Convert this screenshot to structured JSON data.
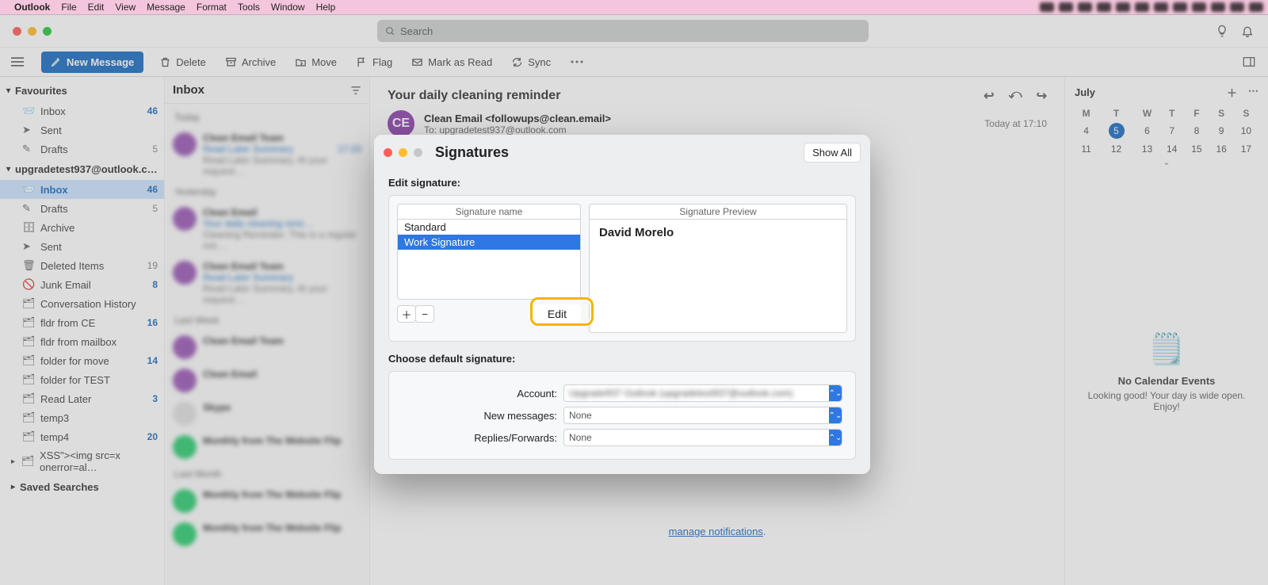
{
  "macmenu": {
    "app": "Outlook",
    "items": [
      "File",
      "Edit",
      "View",
      "Message",
      "Format",
      "Tools",
      "Window",
      "Help"
    ]
  },
  "search_placeholder": "Search",
  "toolbar": {
    "new": "New Message",
    "delete": "Delete",
    "archive": "Archive",
    "move": "Move",
    "flag": "Flag",
    "markread": "Mark as Read",
    "sync": "Sync"
  },
  "sidebar": {
    "favourites": "Favourites",
    "fav": {
      "inbox": {
        "label": "Inbox",
        "count": "46"
      },
      "sent": {
        "label": "Sent"
      },
      "drafts": {
        "label": "Drafts",
        "count": "5"
      }
    },
    "account": "upgradetest937@outlook.c…",
    "items": [
      {
        "label": "Inbox",
        "count": "46",
        "sel": true
      },
      {
        "label": "Drafts",
        "count": "5"
      },
      {
        "label": "Archive"
      },
      {
        "label": "Sent"
      },
      {
        "label": "Deleted Items",
        "count": "19"
      },
      {
        "label": "Junk Email",
        "count": "8"
      },
      {
        "label": "Conversation History"
      },
      {
        "label": "fldr from CE",
        "count": "16"
      },
      {
        "label": "fldr from mailbox"
      },
      {
        "label": "folder for move",
        "count": "14"
      },
      {
        "label": "folder for TEST"
      },
      {
        "label": "Read Later",
        "count": "3"
      },
      {
        "label": "temp3"
      },
      {
        "label": "temp4",
        "count": "20"
      },
      {
        "label": "XSS\"><img src=x onerror=al…"
      }
    ],
    "saved": "Saved Searches"
  },
  "list": {
    "title": "Inbox",
    "today": "Today",
    "yesterday": "Yesterday",
    "lastweek": "Last Week",
    "lastmonth": "Last Month",
    "r": {
      "nm1": "Clean Email Team",
      "ln1": "Read Later Summary",
      "tm": "17:20",
      "pv": "Read Later Summary. At your request…",
      "nm2": "Clean Email",
      "ln2": "Your daily cleaning remi…",
      "pv2": "Cleaning Reminder. This is a regular not…"
    }
  },
  "reader": {
    "subject": "Your daily cleaning reminder",
    "avatar": "CE",
    "sender": "Clean Email <followups@clean.email>",
    "to_lbl": "To:",
    "to": "upgradetest937@outlook.com",
    "time": "Today at 17:10",
    "link": "manage notifications"
  },
  "agenda": {
    "month": "July",
    "dow": [
      "M",
      "T",
      "W",
      "T",
      "F",
      "S",
      "S"
    ],
    "rows": [
      [
        "4",
        "5",
        "6",
        "7",
        "8",
        "9",
        "10"
      ],
      [
        "11",
        "12",
        "13",
        "14",
        "15",
        "16",
        "17"
      ]
    ],
    "noevt": "No Calendar Events",
    "noevt2": "Looking good! Your day is wide open. Enjoy!"
  },
  "modal": {
    "title": "Signatures",
    "showall": "Show All",
    "edit_label": "Edit signature:",
    "sig_name_hdr": "Signature name",
    "sig1": "Standard",
    "sig2": "Work Signature",
    "edit_btn": "Edit",
    "preview_hdr": "Signature Preview",
    "preview_value": "David Morelo",
    "choose_label": "Choose default signature:",
    "account_lbl": "Account:",
    "account_val": "Upgrade937 Outlook (upgradetest937@outlook.com)",
    "newmsg_lbl": "New messages:",
    "newmsg_val": "None",
    "repfw_lbl": "Replies/Forwards:",
    "repfw_val": "None"
  }
}
